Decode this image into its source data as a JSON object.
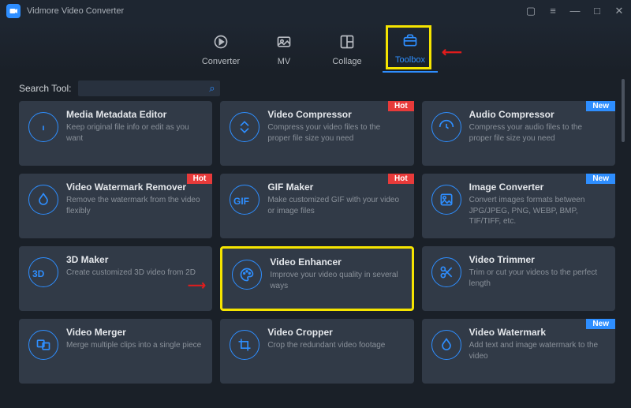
{
  "appTitle": "Vidmore Video Converter",
  "tabs": [
    {
      "label": "Converter",
      "icon": "converter"
    },
    {
      "label": "MV",
      "icon": "mv"
    },
    {
      "label": "Collage",
      "icon": "collage"
    },
    {
      "label": "Toolbox",
      "icon": "toolbox"
    }
  ],
  "activeTab": 3,
  "search": {
    "label": "Search Tool:",
    "placeholder": ""
  },
  "badges": {
    "hot": "Hot",
    "new": "New"
  },
  "tools": [
    {
      "title": "Media Metadata Editor",
      "desc": "Keep original file info or edit as you want",
      "icon": "info",
      "badge": null
    },
    {
      "title": "Video Compressor",
      "desc": "Compress your video files to the proper file size you need",
      "icon": "compress",
      "badge": "hot"
    },
    {
      "title": "Audio Compressor",
      "desc": "Compress your audio files to the proper file size you need",
      "icon": "audio",
      "badge": "new"
    },
    {
      "title": "Video Watermark Remover",
      "desc": "Remove the watermark from the video flexibly",
      "icon": "drop",
      "badge": "hot"
    },
    {
      "title": "GIF Maker",
      "desc": "Make customized GIF with your video or image files",
      "icon": "gif",
      "badge": "hot"
    },
    {
      "title": "Image Converter",
      "desc": "Convert images formats between JPG/JPEG, PNG, WEBP, BMP, TIF/TIFF, etc.",
      "icon": "image",
      "badge": "new"
    },
    {
      "title": "3D Maker",
      "desc": "Create customized 3D video from 2D",
      "icon": "3d",
      "badge": null
    },
    {
      "title": "Video Enhancer",
      "desc": "Improve your video quality in several ways",
      "icon": "palette",
      "badge": null,
      "highlighted": true
    },
    {
      "title": "Video Trimmer",
      "desc": "Trim or cut your videos to the perfect length",
      "icon": "scissors",
      "badge": null
    },
    {
      "title": "Video Merger",
      "desc": "Merge multiple clips into a single piece",
      "icon": "merger",
      "badge": null
    },
    {
      "title": "Video Cropper",
      "desc": "Crop the redundant video footage",
      "icon": "crop",
      "badge": null
    },
    {
      "title": "Video Watermark",
      "desc": "Add text and image watermark to the video",
      "icon": "drop",
      "badge": "new"
    }
  ]
}
